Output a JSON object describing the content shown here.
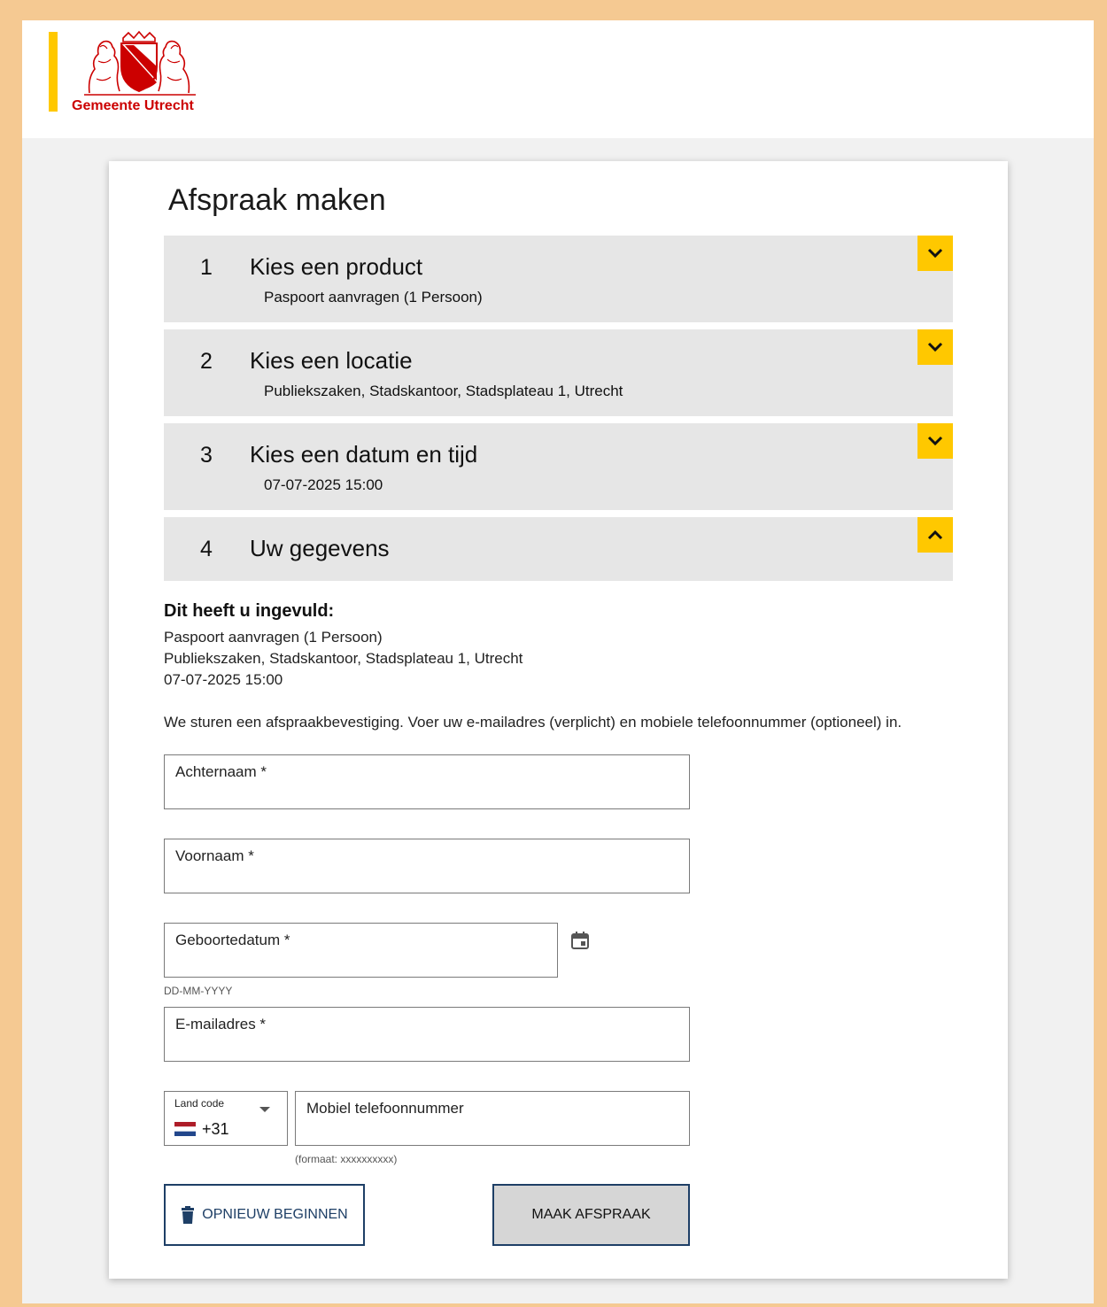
{
  "header": {
    "logo_text": "Gemeente Utrecht",
    "brand_color": "#cc0000",
    "accent_color": "#ffc800"
  },
  "page": {
    "title": "Afspraak maken"
  },
  "steps": [
    {
      "number": "1",
      "title": "Kies een product",
      "summary": "Paspoort aanvragen (1 Persoon)",
      "icon": "chevron-down-icon"
    },
    {
      "number": "2",
      "title": "Kies een locatie",
      "summary": "Publiekszaken, Stadskantoor, Stadsplateau 1, Utrecht",
      "icon": "chevron-down-icon"
    },
    {
      "number": "3",
      "title": "Kies een datum en tijd",
      "summary": "07-07-2025 15:00",
      "icon": "chevron-down-icon"
    },
    {
      "number": "4",
      "title": "Uw gegevens",
      "summary": "",
      "icon": "chevron-up-icon"
    }
  ],
  "summary": {
    "title": "Dit heeft u ingevuld:",
    "lines": [
      "Paspoort aanvragen (1 Persoon)",
      "Publiekszaken, Stadskantoor, Stadsplateau 1, Utrecht",
      "07-07-2025 15:00"
    ]
  },
  "intro": "We sturen een afspraakbevestiging. Voer uw e-mailadres (verplicht) en mobiele telefoonnummer (optioneel) in.",
  "form": {
    "achternaam": {
      "label": "Achternaam *",
      "value": ""
    },
    "voornaam": {
      "label": "Voornaam *",
      "value": ""
    },
    "geboortedatum": {
      "label": "Geboortedatum *",
      "value": "",
      "hint": "DD-MM-YYYY"
    },
    "email": {
      "label": "E-mailadres *",
      "value": ""
    },
    "landcode": {
      "label": "Land code",
      "value": "+31"
    },
    "mobiel": {
      "label": "Mobiel telefoonnummer",
      "value": "",
      "hint": "(formaat: xxxxxxxxxx)"
    }
  },
  "buttons": {
    "restart": "OPNIEUW BEGINNEN",
    "submit": "MAAK AFSPRAAK"
  }
}
